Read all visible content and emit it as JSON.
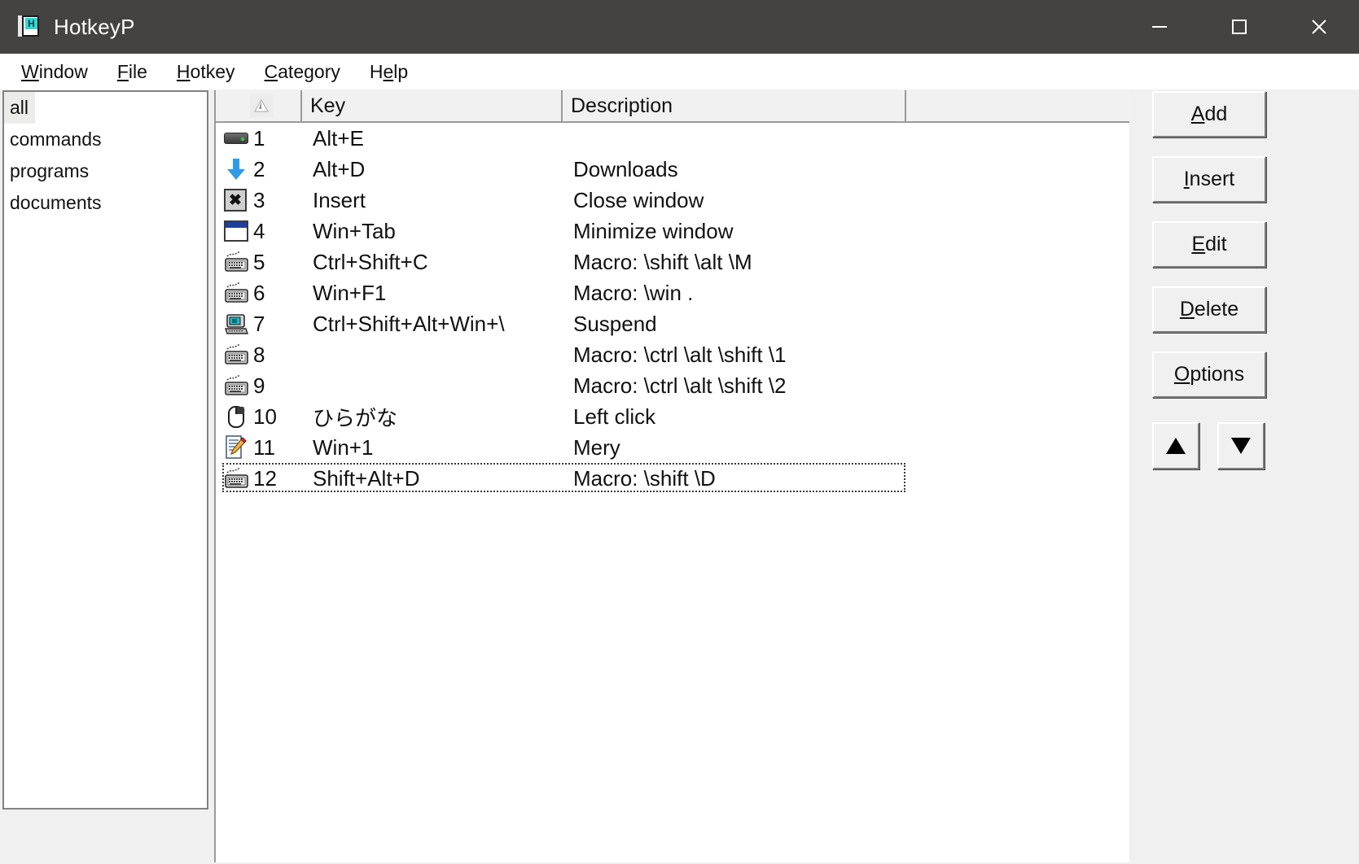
{
  "window": {
    "title": "HotkeyP",
    "icon": "hotkeyp-book-icon",
    "icon_letter": "H",
    "titlebar_color": "#454341",
    "controls": [
      {
        "name": "minimize-button",
        "glyph": "minimize"
      },
      {
        "name": "maximize-button",
        "glyph": "maximize"
      },
      {
        "name": "close-button",
        "glyph": "close"
      }
    ]
  },
  "menubar": {
    "items": [
      {
        "pre": "",
        "acc": "W",
        "post": "indow"
      },
      {
        "pre": "",
        "acc": "F",
        "post": "ile"
      },
      {
        "pre": "",
        "acc": "H",
        "post": "otkey"
      },
      {
        "pre": "",
        "acc": "C",
        "post": "ategory"
      },
      {
        "pre": "H",
        "acc": "e",
        "post": "lp"
      }
    ]
  },
  "sidebar": {
    "items": [
      {
        "label": "all",
        "selected": true
      },
      {
        "label": "commands",
        "selected": false
      },
      {
        "label": "programs",
        "selected": false
      },
      {
        "label": "documents",
        "selected": false
      }
    ]
  },
  "listview": {
    "columns": [
      {
        "name": "sort-column",
        "label": "",
        "glyph": "sort-ascending-triangle"
      },
      {
        "name": "key-column",
        "label": "Key"
      },
      {
        "name": "description-column",
        "label": "Description"
      },
      {
        "name": "blank-column",
        "label": ""
      }
    ],
    "rows": [
      {
        "num": "1",
        "icon": "drive-icon",
        "key": "Alt+E",
        "desc": ""
      },
      {
        "num": "2",
        "icon": "download-arrow-icon",
        "key": "Alt+D",
        "desc": "Downloads"
      },
      {
        "num": "3",
        "icon": "close-window-icon",
        "key": "Insert",
        "desc": "Close window"
      },
      {
        "num": "4",
        "icon": "window-icon",
        "key": "Win+Tab",
        "desc": "Minimize window"
      },
      {
        "num": "5",
        "icon": "keyboard-icon",
        "key": "Ctrl+Shift+C",
        "desc": "Macro: \\shift \\alt \\M"
      },
      {
        "num": "6",
        "icon": "keyboard-icon",
        "key": "Win+F1",
        "desc": "Macro: \\win ."
      },
      {
        "num": "7",
        "icon": "computer-icon",
        "key": "Ctrl+Shift+Alt+Win+\\",
        "desc": "Suspend"
      },
      {
        "num": "8",
        "icon": "keyboard-icon",
        "key": "",
        "desc": "Macro: \\ctrl \\alt \\shift \\1"
      },
      {
        "num": "9",
        "icon": "keyboard-icon",
        "key": "",
        "desc": "Macro: \\ctrl \\alt \\shift \\2"
      },
      {
        "num": "10",
        "icon": "mouse-icon",
        "key": "ひらがな",
        "desc": "Left click"
      },
      {
        "num": "11",
        "icon": "document-edit-icon",
        "key": "Win+1",
        "desc": "Mery"
      },
      {
        "num": "12",
        "icon": "keyboard-icon",
        "key": "Shift+Alt+D",
        "desc": "Macro: \\shift \\D",
        "focused": true
      }
    ]
  },
  "buttons": {
    "add": {
      "pre": "",
      "acc": "A",
      "post": "dd"
    },
    "insert": {
      "pre": "",
      "acc": "I",
      "post": "nsert"
    },
    "edit": {
      "pre": "",
      "acc": "E",
      "post": "dit"
    },
    "delete": {
      "pre": "",
      "acc": "D",
      "post": "elete"
    },
    "options": {
      "pre": "",
      "acc": "O",
      "post": "ptions"
    },
    "move_up": {
      "name": "move-up-button",
      "glyph": "triangle-up"
    },
    "move_down": {
      "name": "move-down-button",
      "glyph": "triangle-down"
    }
  },
  "colors": {
    "titlebar": "#454341",
    "face": "#f0f0f0",
    "selection": "#ececeb",
    "accent_blue": "#2f9ae8",
    "text": "#111111"
  }
}
